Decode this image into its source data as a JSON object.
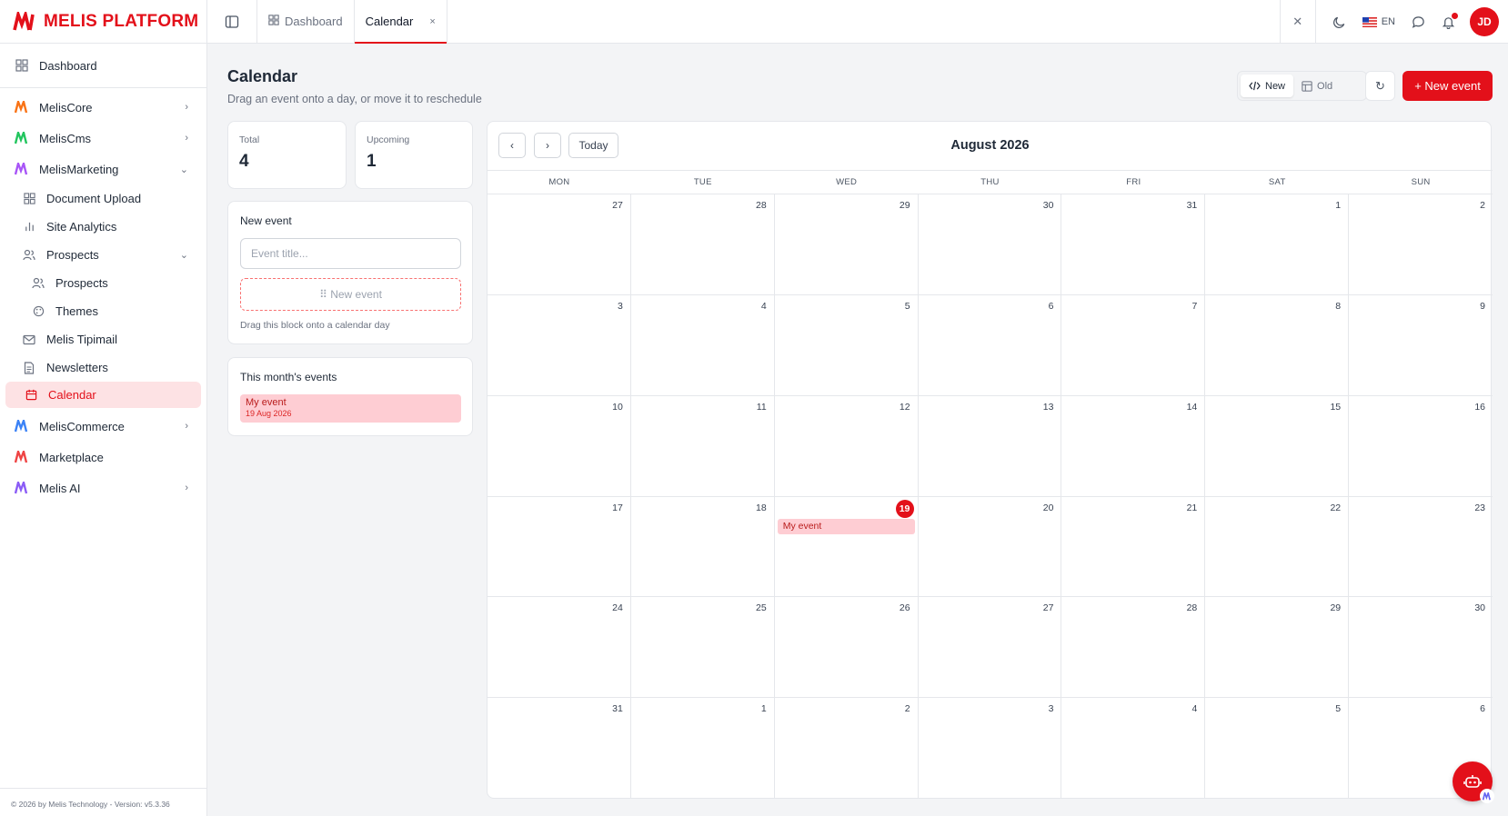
{
  "brand": {
    "name": "MELIS PLATFORM"
  },
  "sidebar": {
    "dashboard": "Dashboard",
    "groups": {
      "core": "MelisCore",
      "cms": "MelisCms",
      "marketing": "MelisMarketing",
      "commerce": "MelisCommerce",
      "marketplace": "Marketplace",
      "ai": "Melis AI"
    },
    "marketing_items": {
      "document_upload": "Document Upload",
      "site_analytics": "Site Analytics",
      "prospects": "Prospects",
      "prospects_sub": "Prospects",
      "themes": "Themes",
      "tipimail": "Melis Tipimail",
      "newsletters": "Newsletters",
      "calendar": "Calendar"
    },
    "footer": "© 2026 by Melis Technology - Version: v5.3.36",
    "group_colors": {
      "core": "#f97316",
      "cms": "#22c55e",
      "marketing": "#a855f7",
      "commerce": "#3b82f6",
      "marketplace": "#ef4444",
      "ai": "#8b5cf6"
    }
  },
  "topbar": {
    "tabs": [
      {
        "label": "Dashboard",
        "icon": "grid-icon"
      },
      {
        "label": "Calendar",
        "close": "×"
      }
    ],
    "close_all": "✕",
    "lang": "EN",
    "avatar": "JD"
  },
  "page": {
    "title": "Calendar",
    "subtitle": "Drag an event onto a day, or move it to reschedule"
  },
  "actions": {
    "view_new": "New",
    "view_old": "Old",
    "refresh": "↻",
    "new_event": "+ New event"
  },
  "stats": {
    "total_label": "Total",
    "total_value": "4",
    "upcoming_label": "Upcoming",
    "upcoming_value": "1"
  },
  "new_event_card": {
    "title": "New event",
    "placeholder": "Event title...",
    "drag_label": "⠿ New event",
    "hint": "Drag this block onto a calendar day"
  },
  "month_events": {
    "title": "This month's events",
    "items": [
      {
        "title": "My event",
        "date": "19 Aug 2026"
      }
    ]
  },
  "calendar": {
    "month_label": "August 2026",
    "prev": "‹",
    "next": "›",
    "today_label": "Today",
    "day_names": [
      "MON",
      "TUE",
      "WED",
      "THU",
      "FRI",
      "SAT",
      "SUN"
    ],
    "today_date": 19,
    "cells": [
      27,
      28,
      29,
      30,
      31,
      1,
      2,
      3,
      4,
      5,
      6,
      7,
      8,
      9,
      10,
      11,
      12,
      13,
      14,
      15,
      16,
      17,
      18,
      19,
      20,
      21,
      22,
      23,
      24,
      25,
      26,
      27,
      28,
      29,
      30,
      31,
      1,
      2,
      3,
      4,
      5,
      6
    ],
    "events": [
      {
        "day": 19,
        "title": "My event"
      }
    ]
  },
  "colors": {
    "accent": "#e3101a",
    "event_bg": "#fecdd3",
    "active_bg": "#fde2e4"
  }
}
